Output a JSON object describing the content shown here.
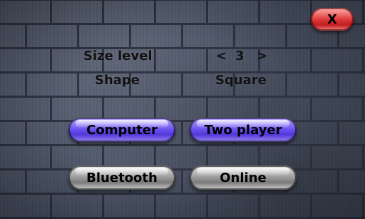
{
  "close": {
    "label": "X"
  },
  "settings": {
    "size_label": "Size level",
    "size_value": "3",
    "size_prev": "<",
    "size_next": ">",
    "shape_label": "Shape",
    "shape_value": "Square"
  },
  "modes": {
    "computer": "Computer",
    "two_player": "Two player",
    "bluetooth": "Bluetooth",
    "online": "Online"
  },
  "colors": {
    "selected_button": "#6a4ff0",
    "default_button": "#9a9a9a",
    "close_button": "#e03a3a"
  }
}
